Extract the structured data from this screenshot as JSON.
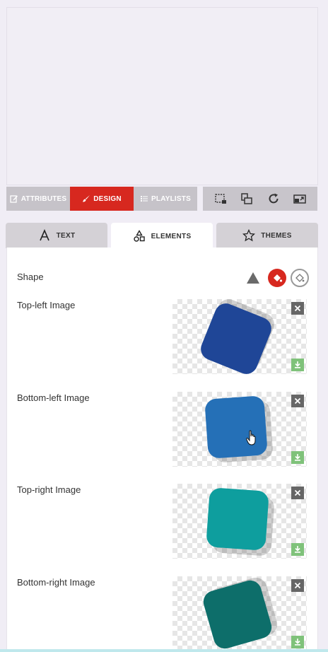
{
  "toolbar": {
    "attributes_label": "ATTRIBUTES",
    "design_label": "DESIGN",
    "playlists_label": "PLAYLISTS"
  },
  "tools": [
    "crop-icon",
    "layers-icon",
    "rotate-icon",
    "resize-icon"
  ],
  "tabs": [
    {
      "label": "TEXT",
      "icon": "letter-a-icon"
    },
    {
      "label": "ELEMENTS",
      "icon": "shapes-icon"
    },
    {
      "label": "THEMES",
      "icon": "star-icon"
    }
  ],
  "panel": {
    "shape_label": "Shape",
    "colors": {
      "accent": "#d7281f"
    },
    "images": [
      {
        "label": "Top-left Image",
        "color": "#1f4697"
      },
      {
        "label": "Bottom-left Image",
        "color": "#2570b7"
      },
      {
        "label": "Top-right Image",
        "color": "#0e9e9e"
      },
      {
        "label": "Bottom-right Image",
        "color": "#0d6e6a"
      }
    ]
  }
}
